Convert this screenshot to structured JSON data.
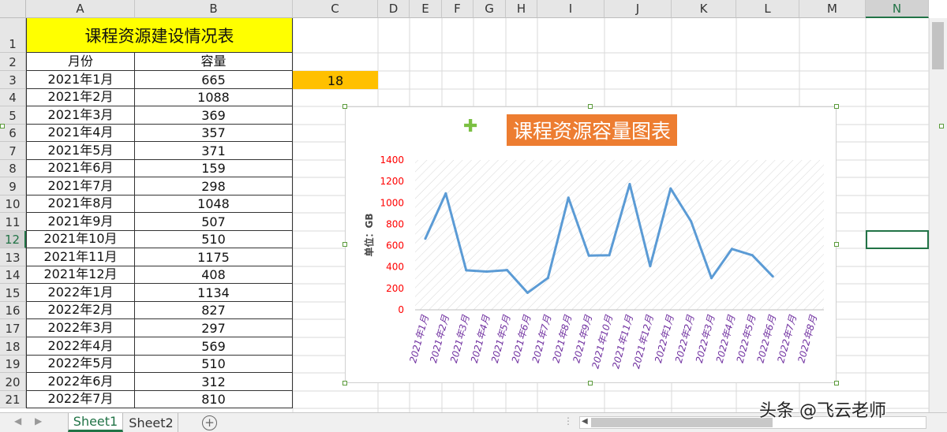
{
  "columns": [
    "A",
    "B",
    "C",
    "D",
    "E",
    "F",
    "G",
    "H",
    "I",
    "J",
    "K",
    "L",
    "M",
    "N"
  ],
  "rows": [
    "1",
    "2",
    "3",
    "4",
    "5",
    "6",
    "7",
    "8",
    "9",
    "10",
    "11",
    "12",
    "13",
    "14",
    "15",
    "16",
    "17",
    "18",
    "19",
    "20",
    "21"
  ],
  "sheet": {
    "title": "课程资源建设情况表",
    "header_month": "月份",
    "header_capacity": "容量",
    "records": [
      {
        "month": "2021年1月",
        "capacity": "665"
      },
      {
        "month": "2021年2月",
        "capacity": "1088"
      },
      {
        "month": "2021年3月",
        "capacity": "369"
      },
      {
        "month": "2021年4月",
        "capacity": "357"
      },
      {
        "month": "2021年5月",
        "capacity": "371"
      },
      {
        "month": "2021年6月",
        "capacity": "159"
      },
      {
        "month": "2021年7月",
        "capacity": "298"
      },
      {
        "month": "2021年8月",
        "capacity": "1048"
      },
      {
        "month": "2021年9月",
        "capacity": "507"
      },
      {
        "month": "2021年10月",
        "capacity": "510"
      },
      {
        "month": "2021年11月",
        "capacity": "1175"
      },
      {
        "month": "2021年12月",
        "capacity": "408"
      },
      {
        "month": "2022年1月",
        "capacity": "1134"
      },
      {
        "month": "2022年2月",
        "capacity": "827"
      },
      {
        "month": "2022年3月",
        "capacity": "297"
      },
      {
        "month": "2022年4月",
        "capacity": "569"
      },
      {
        "month": "2022年5月",
        "capacity": "510"
      },
      {
        "month": "2022年6月",
        "capacity": "312"
      },
      {
        "month": "2022年7月",
        "capacity": "810"
      }
    ],
    "c3_value": "18"
  },
  "tabs": [
    "Sheet1",
    "Sheet2"
  ],
  "watermark": "头条 @飞云老师",
  "chart_data": {
    "type": "line",
    "title": "课程资源容量图表",
    "ylabel": "单位：GB",
    "xlabel": "",
    "categories": [
      "2021年1月",
      "2021年2月",
      "2021年3月",
      "2021年4月",
      "2021年5月",
      "2021年6月",
      "2021年7月",
      "2021年8月",
      "2021年9月",
      "2021年10月",
      "2021年11月",
      "2021年12月",
      "2022年1月",
      "2022年2月",
      "2022年3月",
      "2022年4月",
      "2022年5月",
      "2022年6月",
      "2022年7月",
      "2022年8月"
    ],
    "values": [
      665,
      1088,
      369,
      357,
      371,
      159,
      298,
      1048,
      507,
      510,
      1175,
      408,
      1134,
      827,
      297,
      569,
      510,
      312
    ],
    "yticks": [
      "0",
      "200",
      "400",
      "600",
      "800",
      "1000",
      "1200",
      "1400"
    ],
    "ylim": [
      0,
      1400
    ],
    "line_color": "#5b9bd5",
    "tick_color": "#ff0000",
    "category_color": "#7030a0",
    "title_bg": "#ed7d31",
    "grid": false,
    "plot_pattern": "diagonal-hatch"
  }
}
